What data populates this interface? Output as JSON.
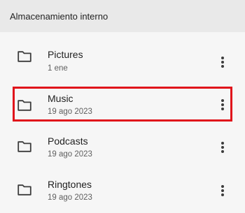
{
  "header": {
    "title": "Almacenamiento interno"
  },
  "folders": [
    {
      "name": "Pictures",
      "date": "1 ene",
      "icon": "folder-icon",
      "more_icon": "more-vert-icon"
    },
    {
      "name": "Music",
      "date": "19 ago 2023",
      "icon": "folder-icon",
      "more_icon": "more-vert-icon",
      "highlighted": true
    },
    {
      "name": "Podcasts",
      "date": "19 ago 2023",
      "icon": "folder-icon",
      "more_icon": "more-vert-icon"
    },
    {
      "name": "Ringtones",
      "date": "19 ago 2023",
      "icon": "folder-icon",
      "more_icon": "more-vert-icon"
    }
  ],
  "colors": {
    "header_bg": "#e9e9e9",
    "list_bg": "#f6f6f6",
    "highlight": "#e0141b"
  }
}
